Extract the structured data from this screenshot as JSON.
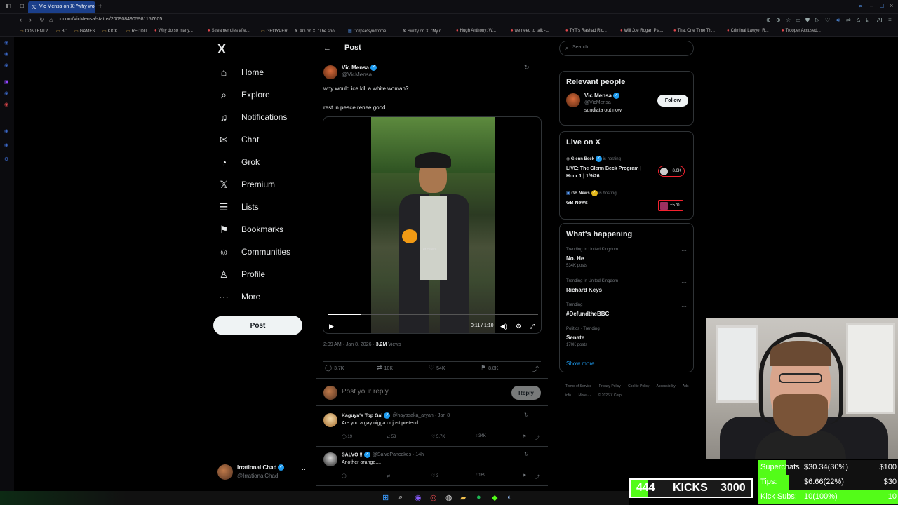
{
  "browser": {
    "active_tab": "Vic Mensa on X: \"why wo",
    "url": "x.com/VicMensa/status/2009084905981157605",
    "bookmarks": [
      "CONTENT?",
      "BC",
      "GAMES",
      "KICK",
      "REDDIT",
      "Why do so many...",
      "Streamer dies afte...",
      "GROYPER",
      "AG on X: \"The sho...",
      "CorpseSyndrome...",
      "Swifty on X: \"My n...",
      "Hugh Anthony: W...",
      "we need to talk -...",
      "TYT's Rashad Ric...",
      "Will Joe Rogan Pla...",
      "That One Time Th...",
      "Criminal Lawyer R...",
      "Trooper Accused..."
    ]
  },
  "sidebar": {
    "logo": "X",
    "items": [
      {
        "label": "Home",
        "icon": "home-icon",
        "glyph": "⌂"
      },
      {
        "label": "Explore",
        "icon": "search-icon",
        "glyph": "⌕"
      },
      {
        "label": "Notifications",
        "icon": "bell-icon",
        "glyph": "♫"
      },
      {
        "label": "Chat",
        "icon": "mail-icon",
        "glyph": "✉"
      },
      {
        "label": "Grok",
        "icon": "grok-icon",
        "glyph": "◔"
      },
      {
        "label": "Premium",
        "icon": "x-premium-icon",
        "glyph": "𝕏"
      },
      {
        "label": "Lists",
        "icon": "list-icon",
        "glyph": "☰"
      },
      {
        "label": "Bookmarks",
        "icon": "bookmark-icon",
        "glyph": "⚑"
      },
      {
        "label": "Communities",
        "icon": "people-icon",
        "glyph": "☺"
      },
      {
        "label": "Profile",
        "icon": "person-icon",
        "glyph": "♙"
      },
      {
        "label": "More",
        "icon": "more-circle-icon",
        "glyph": "⋯"
      }
    ],
    "post_button": "Post",
    "account": {
      "name": "Irrational Chad",
      "handle": "@IrrationalChad"
    }
  },
  "post": {
    "header": "Post",
    "author": {
      "name": "Vic Mensa",
      "handle": "@VicMensa"
    },
    "text_line1": "why would ice kill a white woman?",
    "text_line2": "rest in peace renee good",
    "video": {
      "time": "0:11 / 1:10",
      "progress": 0.16,
      "caption": "et cetera"
    },
    "timestamp": "2:09 AM · Jan 8, 2026 · ",
    "views_count": "3.2M",
    "views_label": " Views",
    "stats": {
      "replies": "3.7K",
      "reposts": "10K",
      "likes": "54K",
      "bookmarks": "8.8K"
    },
    "reply_placeholder": "Post your reply",
    "reply_button": "Reply"
  },
  "replies": [
    {
      "name": "Kaguya's Top Gal",
      "meta": "@hayasaka_aryan · Jan 8",
      "text": "Are you a gay nigga or just pretend",
      "replies": "19",
      "reposts": "53",
      "likes": "5.7K",
      "views": "34K"
    },
    {
      "name": "SALVO ‼",
      "meta": "@SalvoPancakes · 14h",
      "text": "Another orange....",
      "replies": "",
      "reposts": "",
      "likes": "3",
      "views": "169"
    }
  ],
  "right": {
    "search_placeholder": "Search",
    "relevant_title": "Relevant people",
    "relevant_person": {
      "name": "Vic Mensa",
      "handle": "@VicMensa",
      "bio": "sundiata out now",
      "follow": "Follow"
    },
    "live_title": "Live on X",
    "live": [
      {
        "host": "Glenn Beck",
        "hosting": " is hosting",
        "title": "LIVE: The Glenn Beck Program | Hour 1 | 1/9/26",
        "count": "+8.6K"
      },
      {
        "host": "GB News",
        "hosting": " is hosting",
        "title": "GB News",
        "count": "+570"
      }
    ],
    "happening_title": "What's happening",
    "trends": [
      {
        "category": "Trending in United Kingdom",
        "name": "No. He",
        "count": "534K posts"
      },
      {
        "category": "Trending in United Kingdom",
        "name": "Richard Keys",
        "count": ""
      },
      {
        "category": "Trending",
        "name": "#DefundtheBBC",
        "count": ""
      },
      {
        "category": "Politics · Trending",
        "name": "Senate",
        "count": "170K posts"
      }
    ],
    "show_more": "Show more",
    "footer": [
      "Terms of Service",
      "Privacy Policy",
      "Cookie Policy",
      "Accessibility",
      "Ads info",
      "More ···",
      "© 2026 X Corp."
    ]
  },
  "overlay": {
    "kicks": {
      "current": "444",
      "label": "KICKS",
      "goal": "3000",
      "progress": 0.148
    },
    "goals": [
      {
        "label": "Superchats",
        "value": "$30.34(30%)",
        "target": "$100",
        "progress": 0.2
      },
      {
        "label": "Tips:",
        "value": "$6.66(22%)",
        "target": "$30",
        "progress": 0.22
      },
      {
        "label": "Kick Subs:",
        "value": "10(100%)",
        "target": "10",
        "progress": 1.0
      }
    ]
  },
  "colors": {
    "accent": "#1d9bf0",
    "kick_green": "#53fc18",
    "live_red": "#f4212e"
  }
}
